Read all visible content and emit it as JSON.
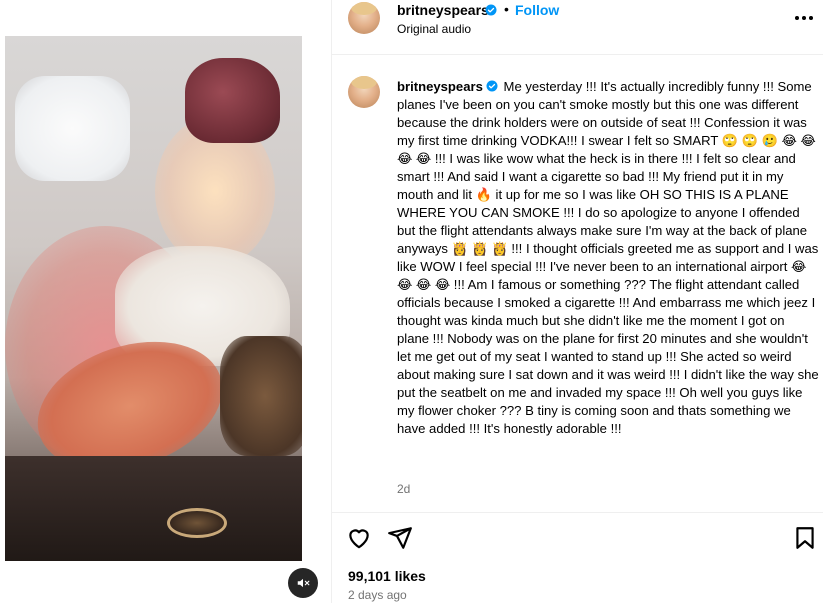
{
  "post": {
    "username": "britneyspears",
    "follow_label": "Follow",
    "separator": "•",
    "audio": "Original audio",
    "caption": "Me yesterday !!! It's actually incredibly funny !!! Some planes I've been on you can't smoke mostly but this one was different because the drink holders were on outside of seat !!! Confession it was my first time drinking VODKA!!! I swear I felt so SMART 🙄 🙄 🥲 😂 😂 😂 😂 !!! I was like wow what the heck is in there !!! I felt so clear and smart !!! And said I want a cigarette so bad !!! My friend put it in my mouth and lit 🔥 it up for me so I was like OH SO THIS IS A PLANE WHERE YOU CAN SMOKE !!! I do so apologize to anyone I offended but the flight attendants always make sure I'm way at the back of plane anyways 👸 👸 👸 !!! I thought officials greeted me as support and I was like WOW I feel special !!! I've never been to an international airport 😂 😂 😂 😂 !!! Am I famous or something ??? The flight attendant called officials because I smoked a cigarette !!! And embarrass me which jeez I thought was kinda much but she didn't like me the moment I got on plane !!! Nobody was on the plane for first 20 minutes and she wouldn't let me get out of my seat I wanted to stand up !!! She acted so weird about making sure I sat down and it was weird !!! I didn't like the way she put the seatbelt on me and invaded my space !!! Oh well you guys like my flower choker ??? B tiny is coming soon and thats something we have added !!! It's honestly adorable !!!",
    "caption_age": "2d",
    "likes": "99,101 likes",
    "posted": "2 days ago"
  },
  "icons": {
    "verified": "verified-badge-icon",
    "more": "more-options-icon",
    "mute": "muted-speaker-icon",
    "like": "heart-icon",
    "share": "paper-plane-icon",
    "save": "bookmark-icon"
  },
  "colors": {
    "accent": "#0095f6",
    "secondary_text": "#737373",
    "divider": "#efefef"
  }
}
